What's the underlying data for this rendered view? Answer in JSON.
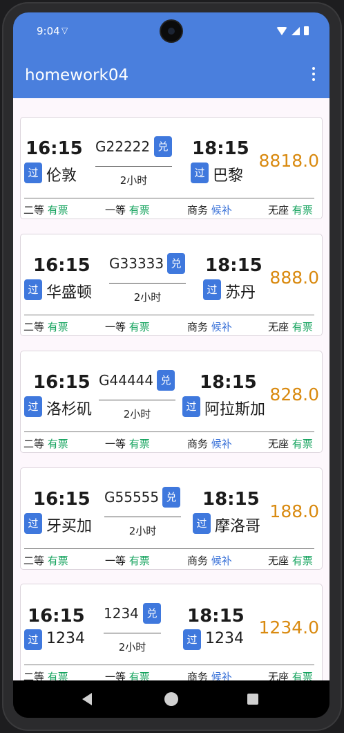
{
  "status": {
    "time": "9:04",
    "vpn_icon": "vpn-key-icon"
  },
  "appbar": {
    "title": "homework04",
    "menu_icon": "more-vert-icon"
  },
  "labels": {
    "transit_badge": "过",
    "ticket_badge": "兑"
  },
  "colors": {
    "primary": "#4a7fdd",
    "badge": "#3f78dd",
    "price": "#d98a10",
    "available": "#15a35e",
    "waitlist": "#3a72d8"
  },
  "trains": [
    {
      "depart_time": "16:15",
      "depart_station": "伦敦",
      "train_no": "G22222",
      "duration": "2小时",
      "arrive_time": "18:15",
      "arrive_station": "巴黎",
      "price": "8818.0",
      "seats": [
        {
          "class": "二等",
          "status": "有票"
        },
        {
          "class": "一等",
          "status": "有票"
        },
        {
          "class": "商务",
          "status": "候补"
        },
        {
          "class": "无座",
          "status": "有票"
        }
      ]
    },
    {
      "depart_time": "16:15",
      "depart_station": "华盛顿",
      "train_no": "G33333",
      "duration": "2小时",
      "arrive_time": "18:15",
      "arrive_station": "苏丹",
      "price": "888.0",
      "seats": [
        {
          "class": "二等",
          "status": "有票"
        },
        {
          "class": "一等",
          "status": "有票"
        },
        {
          "class": "商务",
          "status": "候补"
        },
        {
          "class": "无座",
          "status": "有票"
        }
      ]
    },
    {
      "depart_time": "16:15",
      "depart_station": "洛杉矶",
      "train_no": "G44444",
      "duration": "2小时",
      "arrive_time": "18:15",
      "arrive_station": "阿拉斯加",
      "price": "828.0",
      "seats": [
        {
          "class": "二等",
          "status": "有票"
        },
        {
          "class": "一等",
          "status": "有票"
        },
        {
          "class": "商务",
          "status": "候补"
        },
        {
          "class": "无座",
          "status": "有票"
        }
      ]
    },
    {
      "depart_time": "16:15",
      "depart_station": "牙买加",
      "train_no": "G55555",
      "duration": "2小时",
      "arrive_time": "18:15",
      "arrive_station": "摩洛哥",
      "price": "188.0",
      "seats": [
        {
          "class": "二等",
          "status": "有票"
        },
        {
          "class": "一等",
          "status": "有票"
        },
        {
          "class": "商务",
          "status": "候补"
        },
        {
          "class": "无座",
          "status": "有票"
        }
      ]
    },
    {
      "depart_time": "16:15",
      "depart_station": "1234",
      "train_no": "1234",
      "duration": "2小时",
      "arrive_time": "18:15",
      "arrive_station": "1234",
      "price": "1234.0",
      "seats": [
        {
          "class": "二等",
          "status": "有票"
        },
        {
          "class": "一等",
          "status": "有票"
        },
        {
          "class": "商务",
          "status": "候补"
        },
        {
          "class": "无座",
          "status": "有票"
        }
      ]
    }
  ]
}
